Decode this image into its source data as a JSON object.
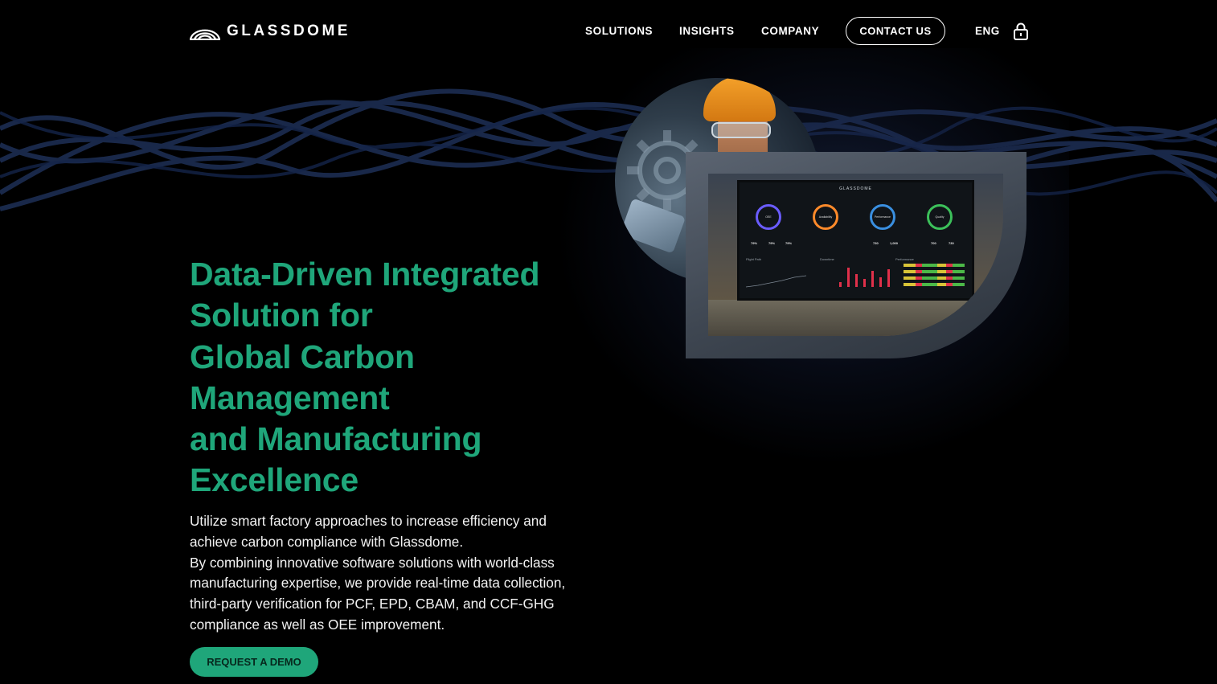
{
  "brand": {
    "name": "GLASSDOME",
    "logo_icon": "dome-arc-icon"
  },
  "nav": {
    "items": [
      {
        "label": "SOLUTIONS"
      },
      {
        "label": "INSIGHTS"
      },
      {
        "label": "COMPANY"
      }
    ],
    "contact_label": "CONTACT US",
    "language": "ENG",
    "lock_icon": "lock-icon"
  },
  "hero": {
    "title_lines": [
      "Data-Driven Integrated",
      "Solution for",
      "Global Carbon",
      "Management",
      "and Manufacturing",
      "Excellence"
    ],
    "description_lines": [
      "Utilize smart factory approaches to increase efficiency and",
      "achieve carbon compliance with Glassdome.",
      "By combining innovative software solutions with world-class",
      "manufacturing expertise, we provide real-time data collection,",
      "third-party verification for PCF, EPD, CBAM, and CCF-GHG",
      "compliance as well as OEE improvement."
    ],
    "cta_label": "REQUEST A DEMO"
  },
  "dashboard": {
    "brand": "GLASSDOME",
    "gauges": [
      {
        "label": "OEE",
        "color": "#6a5cff"
      },
      {
        "label": "Availability",
        "color": "#ff8a2a"
      },
      {
        "label": "Performance",
        "color": "#3a8fe0"
      },
      {
        "label": "Quality",
        "color": "#3cc05a"
      }
    ],
    "gauge_values": [
      "79%",
      "79%",
      "79%",
      "730",
      "1,000",
      "700",
      "730"
    ],
    "section_labels": [
      "Flight Path",
      "Downtime",
      "Performance"
    ]
  },
  "colors": {
    "accent": "#1fa67a",
    "background": "#000000",
    "wave": "#1c2d52"
  }
}
